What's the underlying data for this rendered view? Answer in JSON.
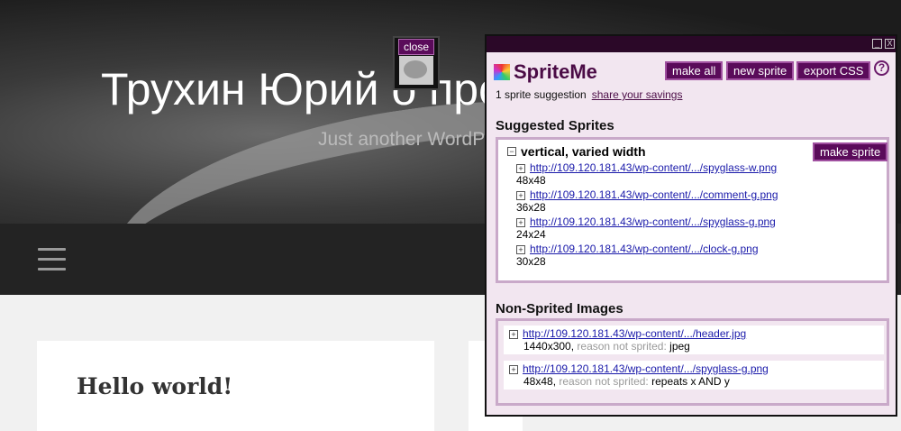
{
  "site": {
    "title": "Трухин Юрий о программировании",
    "tagline": "Just another WordPress site",
    "post_title": "Hello world!"
  },
  "overlay": {
    "close_label": "close"
  },
  "panel": {
    "app_name": "SpriteMe",
    "window_buttons": {
      "minimize": "_",
      "close": "X"
    },
    "buttons": {
      "make_all": "make all",
      "new_sprite": "new sprite",
      "export_css": "export CSS",
      "help": "?"
    },
    "summary": "1 sprite suggestion",
    "share_link": "share your savings",
    "suggested_heading": "Suggested Sprites",
    "sprite_group": {
      "name": "vertical, varied width",
      "make_sprite": "make sprite",
      "items": [
        {
          "url": "http://109.120.181.43/wp-content/.../spyglass-w.png",
          "size": "48x48"
        },
        {
          "url": "http://109.120.181.43/wp-content/.../comment-g.png",
          "size": "36x28"
        },
        {
          "url": "http://109.120.181.43/wp-content/.../spyglass-g.png",
          "size": "24x24"
        },
        {
          "url": "http://109.120.181.43/wp-content/.../clock-g.png",
          "size": "30x28"
        }
      ]
    },
    "nonsprited_heading": "Non-Sprited Images",
    "nonsprited": [
      {
        "url": "http://109.120.181.43/wp-content/.../header.jpg",
        "size": "1440x300,",
        "reason_label": "reason not sprited:",
        "reason": "jpeg"
      },
      {
        "url": "http://109.120.181.43/wp-content/.../spyglass-g.png",
        "size": "48x48,",
        "reason_label": "reason not sprited:",
        "reason": "repeats x AND y"
      }
    ]
  }
}
